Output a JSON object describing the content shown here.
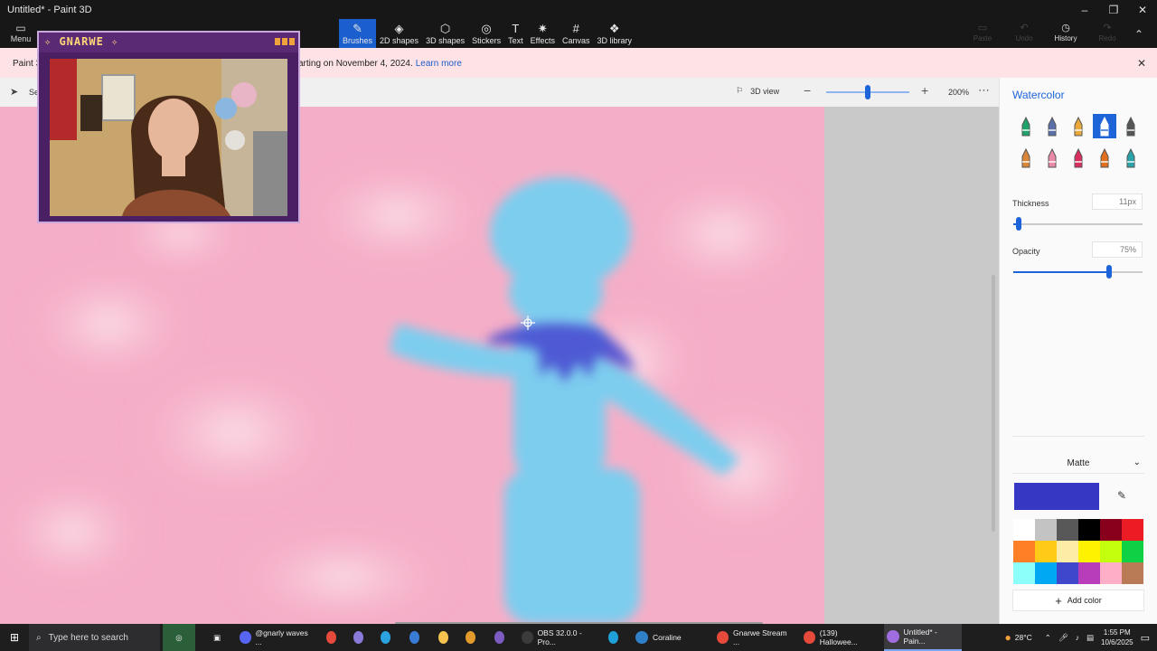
{
  "window": {
    "title": "Untitled* - Paint 3D",
    "controls": [
      "–",
      "❐",
      "✕"
    ]
  },
  "ribbon": {
    "menu_label": "Menu",
    "tools": [
      {
        "label": "Brushes",
        "icon": "brush-icon",
        "glyph": "✎",
        "active": true
      },
      {
        "label": "2D shapes",
        "icon": "shapes-2d-icon",
        "glyph": "◈",
        "active": false
      },
      {
        "label": "3D shapes",
        "icon": "cube-icon",
        "glyph": "⬡",
        "active": false
      },
      {
        "label": "Stickers",
        "icon": "sticker-icon",
        "glyph": "◎",
        "active": false
      },
      {
        "label": "Text",
        "icon": "text-icon",
        "glyph": "T",
        "active": false
      },
      {
        "label": "Effects",
        "icon": "effects-icon",
        "glyph": "✷",
        "active": false
      },
      {
        "label": "Canvas",
        "icon": "canvas-icon",
        "glyph": "#",
        "active": false
      },
      {
        "label": "3D library",
        "icon": "library-icon",
        "glyph": "❖",
        "active": false
      }
    ],
    "right": [
      {
        "label": "Paste",
        "icon": "paste-icon",
        "glyph": "▭",
        "enabled": false
      },
      {
        "label": "Undo",
        "icon": "undo-icon",
        "glyph": "↶",
        "enabled": false
      },
      {
        "label": "History",
        "icon": "history-icon",
        "glyph": "◷",
        "enabled": true
      },
      {
        "label": "Redo",
        "icon": "redo-icon",
        "glyph": "↷",
        "enabled": false
      }
    ]
  },
  "banner": {
    "prefix": "Paint 3",
    "text": "arting on November 4, 2024.",
    "link": "Learn more"
  },
  "canvas_bar": {
    "select_label": "Se",
    "view_3d_label": "3D view",
    "zoom_level": "200%",
    "zoom_fraction": 0.5
  },
  "webcam": {
    "title": "✧ GNARWE ✧"
  },
  "panel": {
    "title": "Watercolor",
    "brushes": [
      {
        "name": "marker-brush",
        "color": "#1fa36b",
        "active": false
      },
      {
        "name": "calligraphy-pen-brush",
        "color": "#5a6ea8",
        "active": false
      },
      {
        "name": "oil-brush",
        "color": "#e8a93a",
        "active": false
      },
      {
        "name": "watercolor-brush",
        "color": "#ffffff",
        "active": true
      },
      {
        "name": "pixel-pen-brush",
        "color": "#555555",
        "active": false
      },
      {
        "name": "pencil-brush",
        "color": "#d9863a",
        "active": false
      },
      {
        "name": "eraser-brush",
        "color": "#e88aa8",
        "active": false
      },
      {
        "name": "crayon-brush",
        "color": "#d92f5e",
        "active": false
      },
      {
        "name": "spray-can-brush",
        "color": "#e06e1c",
        "active": false
      },
      {
        "name": "fill-brush",
        "color": "#2aa3a8",
        "active": false
      }
    ],
    "thickness_label": "Thickness",
    "thickness_value": "11px",
    "thickness_fraction": 0.04,
    "opacity_label": "Opacity",
    "opacity_value": "75%",
    "opacity_fraction": 0.74,
    "finish": "Matte",
    "current_color": "#3638c4",
    "palette": [
      "#ffffff",
      "#c3c3c3",
      "#585858",
      "#000000",
      "#88001b",
      "#ec1c24",
      "#ff7f27",
      "#ffca18",
      "#fdeca6",
      "#fff200",
      "#c4ff0e",
      "#0ed145",
      "#8cfffb",
      "#00a8f3",
      "#3f48cc",
      "#b83dba",
      "#ffaec8",
      "#b97a56"
    ],
    "add_color_label": "Add color"
  },
  "taskbar": {
    "search_placeholder": "Type here to search",
    "items": [
      {
        "label": "@gnarly waves ...",
        "icon": "discord-icon",
        "color": "#5865f2"
      },
      {
        "label": "",
        "icon": "chrome-icon",
        "color": "#e64a3b"
      },
      {
        "label": "",
        "icon": "game-icon",
        "color": "#8a7bd8"
      },
      {
        "label": "",
        "icon": "telegram-icon",
        "color": "#2aa3e0"
      },
      {
        "label": "",
        "icon": "pen-app-icon",
        "color": "#3a7bd5"
      },
      {
        "label": "",
        "icon": "folder-icon",
        "color": "#f4c24d"
      },
      {
        "label": "",
        "icon": "burger-app-icon",
        "color": "#e39b2c"
      },
      {
        "label": "",
        "icon": "media-app-icon",
        "color": "#7d5cc2"
      },
      {
        "label": "OBS 32.0.0 - Pro...",
        "icon": "obs-icon",
        "color": "#3b3b3b"
      },
      {
        "label": "",
        "icon": "edge-icon",
        "color": "#1fa0d8"
      },
      {
        "label": "Coraline",
        "icon": "vscode-icon",
        "color": "#2f80c8"
      },
      {
        "label": "Gnarwe Stream ...",
        "icon": "chrome-icon",
        "color": "#e64a3b"
      },
      {
        "label": "(139) Hallowee...",
        "icon": "chrome-icon",
        "color": "#e64a3b"
      },
      {
        "label": "Untitled* - Pain...",
        "icon": "paint3d-icon",
        "color": "#a06de0"
      }
    ],
    "weather": "28°C",
    "time": "1:55 PM",
    "date": "10/6/2025"
  }
}
